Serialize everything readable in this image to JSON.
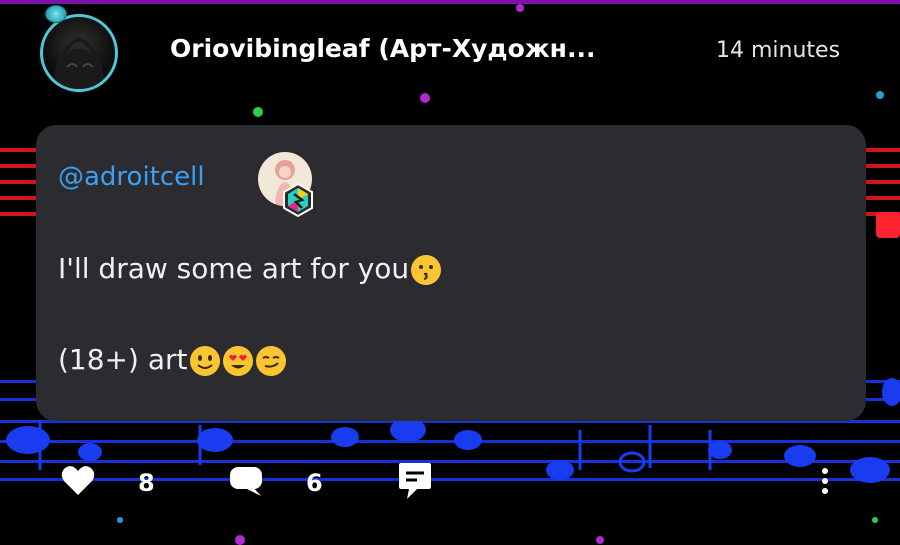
{
  "post": {
    "username": "Oriovibingleaf (Арт-Художн...",
    "timestamp": "14 minutes"
  },
  "comment": {
    "mention": "@adroitcell",
    "line1": "I'll draw some art for you",
    "line2": "(18+) art"
  },
  "actions": {
    "likes": "8",
    "comments": "6"
  },
  "colors": {
    "card_bg": "#2c2c30",
    "mention": "#3aa0f5",
    "avatar_ring": "#4fc7d8",
    "staff_red": "#d0141c",
    "staff_blue": "#1432d8"
  },
  "icons": [
    "heart-icon",
    "comment-bubble-icon",
    "share-icon",
    "more-vertical-icon",
    "kiss-emoji",
    "smile-emoji",
    "heart-eyes-emoji",
    "smirk-emoji"
  ]
}
